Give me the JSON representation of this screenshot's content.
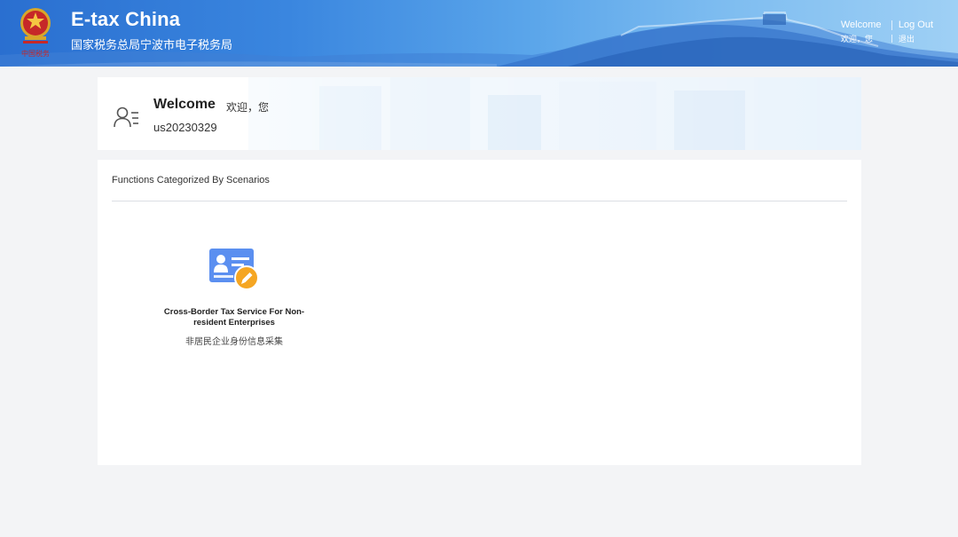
{
  "header": {
    "title": "E-tax China",
    "subtitle": "国家税务总局宁波市电子税务局",
    "emblem_caption": "中国税务",
    "links": {
      "welcome_en": "Welcome",
      "logout_en": "Log Out",
      "welcome_cn": "欢迎，您",
      "logout_cn": "退出"
    }
  },
  "welcome_card": {
    "title": "Welcome",
    "title_cn": "欢迎，您",
    "username": "us20230329"
  },
  "functions": {
    "section_title": "Functions Categorized By Scenarios",
    "items": [
      {
        "name_en": "Cross-Border Tax Service For Non-resident Enterprises",
        "name_cn": "非居民企业身份信息采集",
        "icon": "id-card-edit-icon"
      }
    ]
  },
  "colors": {
    "header_blue": "#2a6fd0",
    "page_bg": "#f3f4f6",
    "icon_blue": "#5b8ff0",
    "icon_orange": "#f5a623"
  }
}
